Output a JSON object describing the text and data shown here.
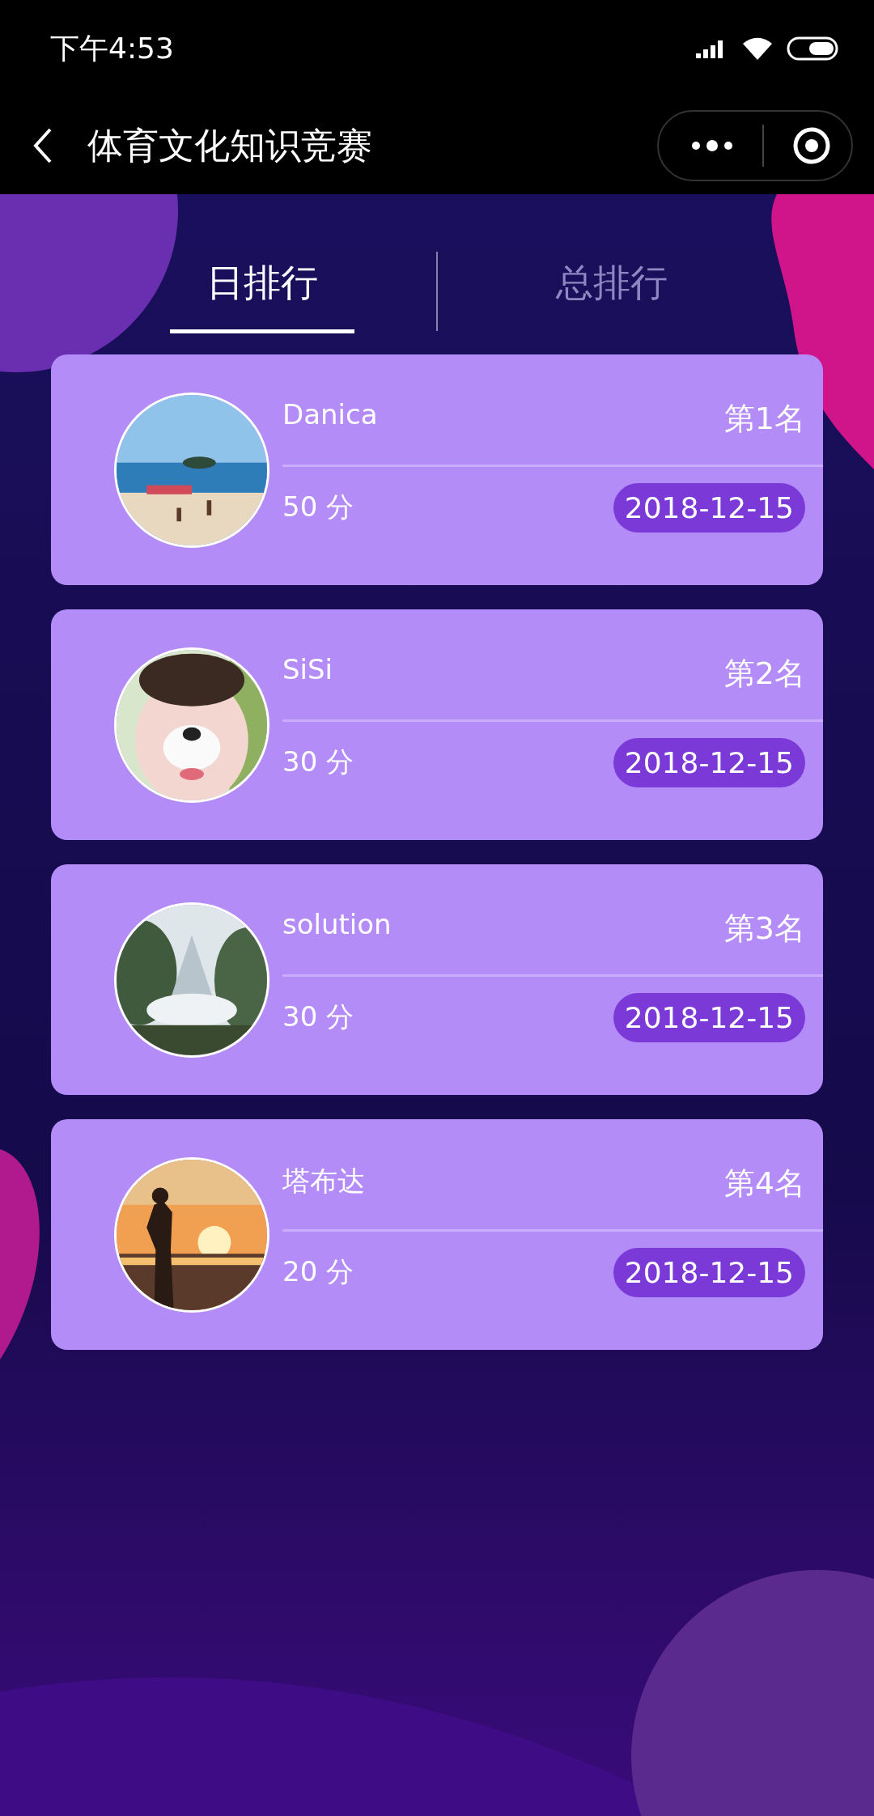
{
  "status_bar": {
    "time": "下午4:53"
  },
  "nav": {
    "title": "体育文化知识竞赛"
  },
  "tabs": [
    {
      "label": "日排行",
      "selected": true
    },
    {
      "label": "总排行",
      "selected": false
    }
  ],
  "entries": [
    {
      "name": "Danica",
      "rank": "第1名",
      "score": "50 分",
      "date": "2018-12-15"
    },
    {
      "name": "SiSi",
      "rank": "第2名",
      "score": "30 分",
      "date": "2018-12-15"
    },
    {
      "name": "solution",
      "rank": "第3名",
      "score": "30 分",
      "date": "2018-12-15"
    },
    {
      "name": "塔布达",
      "rank": "第4名",
      "score": "20 分",
      "date": "2018-12-15"
    }
  ]
}
